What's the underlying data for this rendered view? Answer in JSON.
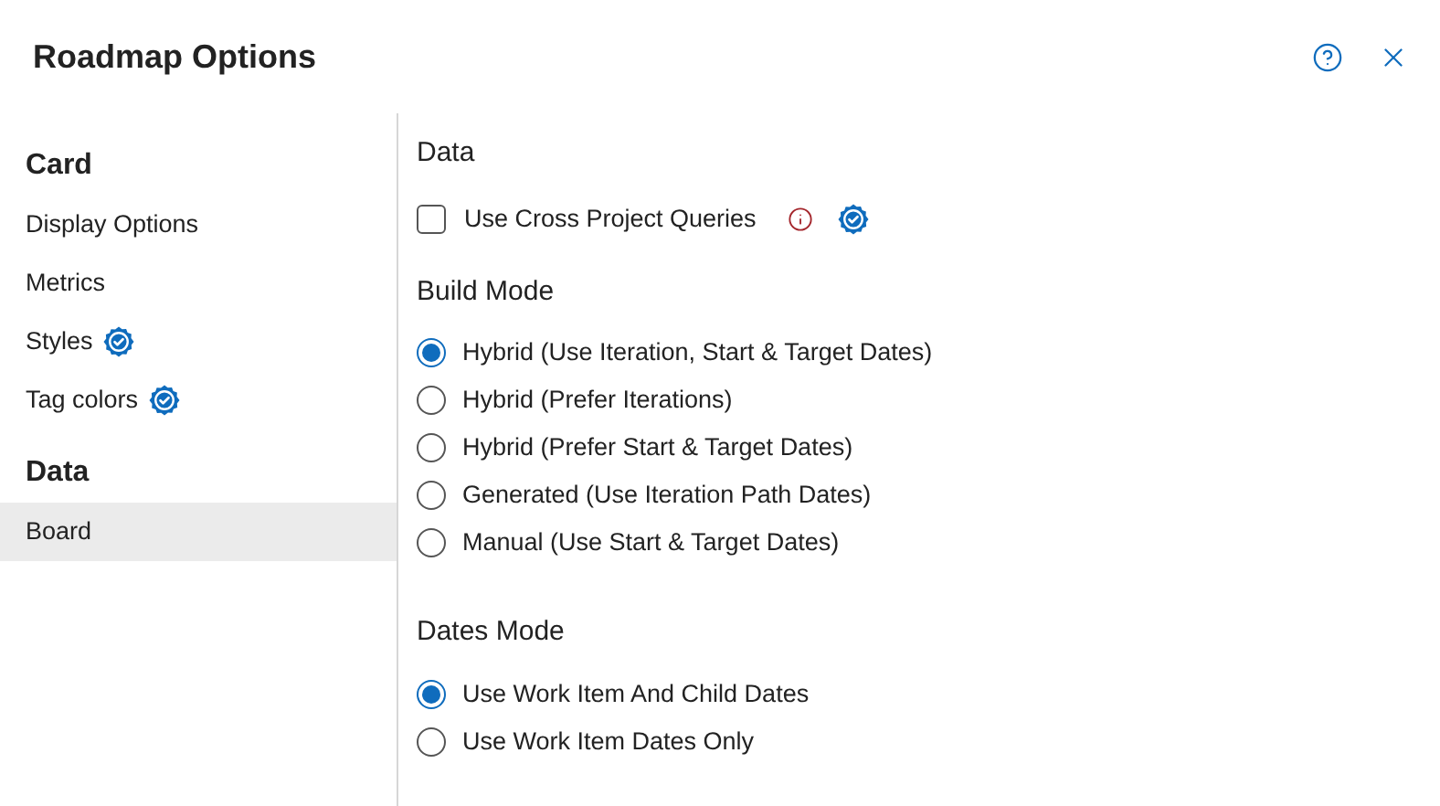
{
  "dialog": {
    "title": "Roadmap Options"
  },
  "sidebar": {
    "sections": [
      {
        "heading": "Card",
        "items": [
          {
            "label": "Display Options",
            "verified": false,
            "selected": false
          },
          {
            "label": "Metrics",
            "verified": false,
            "selected": false
          },
          {
            "label": "Styles",
            "verified": true,
            "selected": false
          },
          {
            "label": "Tag colors",
            "verified": true,
            "selected": false
          }
        ]
      },
      {
        "heading": "Data",
        "items": [
          {
            "label": "Board",
            "verified": false,
            "selected": true
          }
        ]
      }
    ]
  },
  "content": {
    "data_section": {
      "heading": "Data",
      "checkbox": {
        "label": "Use Cross Project Queries",
        "checked": false,
        "info": true,
        "verified": true
      }
    },
    "build_mode": {
      "heading": "Build Mode",
      "options": [
        {
          "label": "Hybrid (Use Iteration, Start & Target Dates)",
          "selected": true
        },
        {
          "label": "Hybrid (Prefer Iterations)",
          "selected": false
        },
        {
          "label": "Hybrid (Prefer Start & Target Dates)",
          "selected": false
        },
        {
          "label": "Generated (Use Iteration Path Dates)",
          "selected": false
        },
        {
          "label": "Manual (Use Start & Target Dates)",
          "selected": false
        }
      ]
    },
    "dates_mode": {
      "heading": "Dates Mode",
      "options": [
        {
          "label": "Use Work Item And Child Dates",
          "selected": true
        },
        {
          "label": "Use Work Item Dates Only",
          "selected": false
        }
      ]
    }
  }
}
